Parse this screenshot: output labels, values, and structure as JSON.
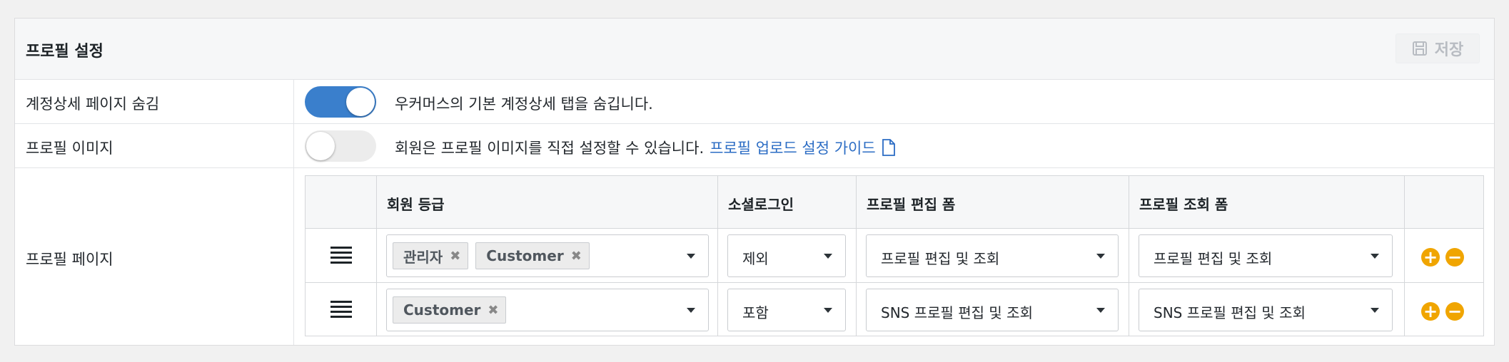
{
  "panel": {
    "title": "프로필 설정",
    "save_label": "저장"
  },
  "rows": {
    "account_hide": {
      "label": "계정상세 페이지 숨김",
      "toggle_on": true,
      "desc": "우커머스의 기본 계정상세 탭을 숨깁니다."
    },
    "profile_image": {
      "label": "프로필 이미지",
      "toggle_on": false,
      "desc": "회원은 프로필 이미지를 직접 설정할 수 있습니다.",
      "link_text": "프로필 업로드 설정 가이드"
    },
    "profile_page": {
      "label": "프로필 페이지"
    }
  },
  "table": {
    "headers": {
      "grade": "회원 등급",
      "social": "소셜로그인",
      "edit_form": "프로필 편집 폼",
      "view_form": "프로필 조회 폼"
    },
    "rows": [
      {
        "grades": [
          "관리자",
          "Customer"
        ],
        "social": "제외",
        "edit_form": "프로필 편집 및 조회",
        "view_form": "프로필 편집 및 조회"
      },
      {
        "grades": [
          "Customer"
        ],
        "social": "포함",
        "edit_form": "SNS 프로필 편집 및 조회",
        "view_form": "SNS 프로필 편집 및 조회"
      }
    ]
  },
  "icons": {
    "save": "save-icon",
    "doc": "document-icon",
    "drag": "drag-handle-icon",
    "remove_tag": "close-icon",
    "add": "plus-circle-icon",
    "remove": "minus-circle-icon"
  },
  "colors": {
    "accent": "#3a7fcc",
    "link": "#2b6cc4",
    "action": "#f0a500"
  }
}
